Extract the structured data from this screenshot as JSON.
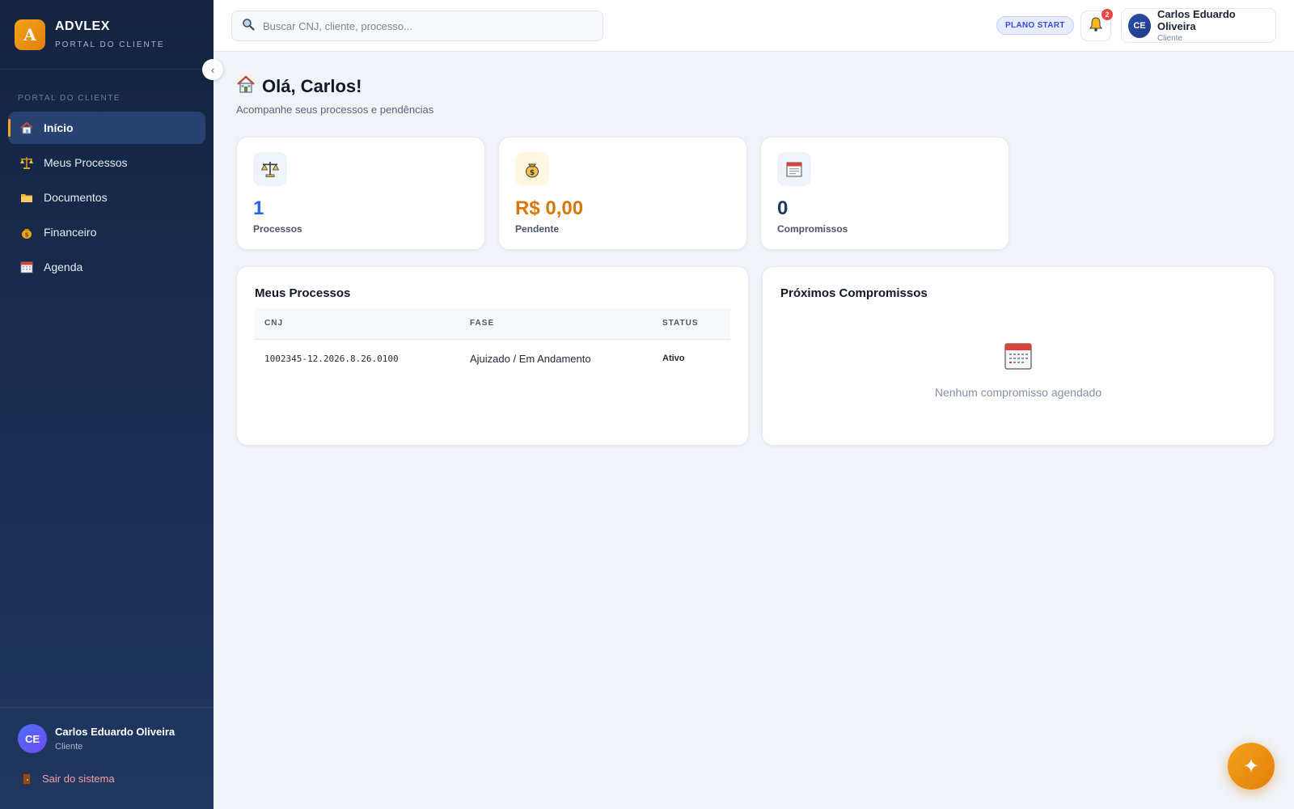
{
  "brand": {
    "logo_letter": "A",
    "name": "ADVLEX",
    "subtitle": "PORTAL DO CLIENTE"
  },
  "sidebar": {
    "section_label": "PORTAL DO CLIENTE",
    "items": [
      {
        "label": "Início",
        "icon": "house-icon",
        "active": true
      },
      {
        "label": "Meus Processos",
        "icon": "scales-icon",
        "active": false
      },
      {
        "label": "Documentos",
        "icon": "folder-icon",
        "active": false
      },
      {
        "label": "Financeiro",
        "icon": "money-bag-icon",
        "active": false
      },
      {
        "label": "Agenda",
        "icon": "calendar-icon",
        "active": false
      }
    ],
    "collapse_glyph": "‹",
    "user": {
      "initials": "CE",
      "name": "Carlos Eduardo Oliveira",
      "role": "Cliente"
    },
    "logout_label": "Sair do sistema"
  },
  "topbar": {
    "search_placeholder": "Buscar CNJ, cliente, processo...",
    "plan_badge": "PLANO START",
    "notification_count": "2",
    "profile": {
      "initials": "CE",
      "name": "Carlos Eduardo Oliveira",
      "role": "Cliente"
    }
  },
  "main": {
    "greeting": "Olá, Carlos!",
    "subtitle": "Acompanhe seus processos e pendências",
    "stats": [
      {
        "value": "1",
        "label": "Processos",
        "color": "#2563eb",
        "icon": "scales-icon"
      },
      {
        "value": "R$ 0,00",
        "label": "Pendente",
        "color": "#d97706",
        "icon": "money-bag-icon"
      },
      {
        "value": "0",
        "label": "Compromissos",
        "color": "#1e3a5f",
        "icon": "calendar-icon"
      }
    ],
    "processes": {
      "title": "Meus Processos",
      "columns": [
        "CNJ",
        "FASE",
        "STATUS"
      ],
      "rows": [
        {
          "cnj": "1002345-12.2026.8.26.0100",
          "fase": "Ajuizado / Em Andamento",
          "status": "Ativo"
        }
      ]
    },
    "appointments": {
      "title": "Próximos Compromissos",
      "empty_text": "Nenhum compromisso agendado"
    }
  },
  "fab": {
    "icon": "sparkle-icon",
    "glyph": "✦"
  },
  "colors": {
    "sidebar_bg": "#1a2e52",
    "accent": "#f5a524",
    "plan_badge": "#3a4bd8",
    "notification": "#ef4444"
  }
}
